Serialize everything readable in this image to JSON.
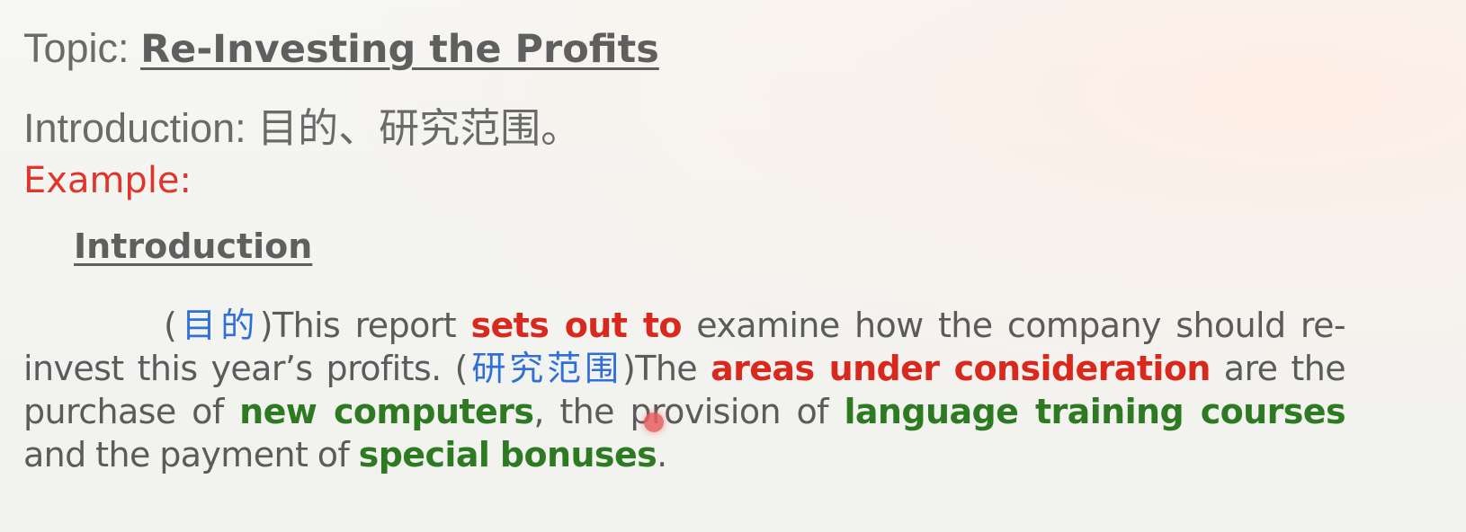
{
  "topic": {
    "label": "Topic: ",
    "title": "Re-Investing the Profits"
  },
  "introduction_line": {
    "label": "Introduction: ",
    "content": "目的、研究范围。"
  },
  "example": {
    "label": "Example:"
  },
  "section": {
    "heading": "Introduction"
  },
  "paragraph": {
    "marker_purpose": "(目的)",
    "text_1": "This report ",
    "phrase_1": "sets out to",
    "text_2": " examine how the company should re-invest this year’s profits. ",
    "marker_scope": "(研究范围)",
    "text_3": "The ",
    "phrase_2": "areas under consideration",
    "text_4": " are the purchase of ",
    "phrase_3": "new computers",
    "text_5": ", the provision of ",
    "phrase_4": "language training courses",
    "text_6": " and the payment of ",
    "phrase_5": "special bonuses",
    "text_7": "."
  },
  "colors": {
    "text": "#5b5b5b",
    "heading_red": "#e0352b",
    "keyword_red": "#d9291e",
    "keyword_green": "#2d7a22",
    "chinese_blue": "#2f6fd6",
    "pointer": "#e85f5f"
  }
}
